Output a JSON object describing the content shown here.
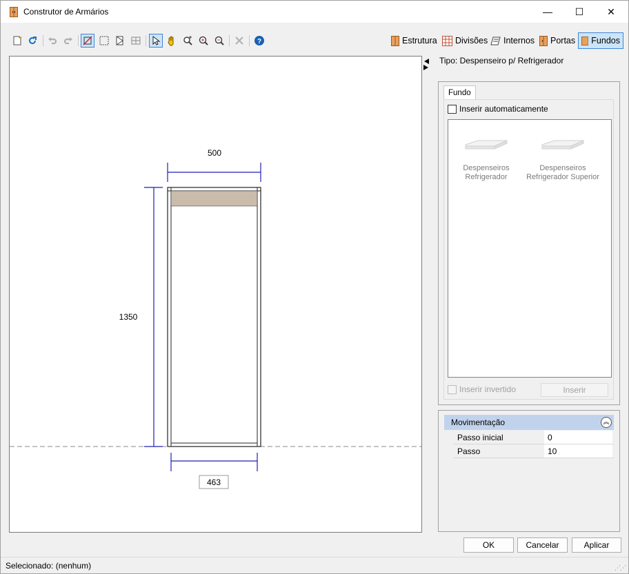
{
  "window": {
    "title": "Construtor de Armários",
    "minimize_glyph": "—",
    "maximize_glyph": "☐",
    "close_glyph": "✕"
  },
  "toolbar": {
    "modes": [
      {
        "label": "Estrutura",
        "icon": "cabinet-icon"
      },
      {
        "label": "Divisões",
        "icon": "grid-icon"
      },
      {
        "label": "Internos",
        "icon": "shelf-icon"
      },
      {
        "label": "Portas",
        "icon": "door-icon"
      },
      {
        "label": "Fundos",
        "icon": "back-panel-icon",
        "active": true
      }
    ]
  },
  "canvas": {
    "dim_width": "500",
    "dim_height": "1350",
    "dim_bottom": "463"
  },
  "panel": {
    "tipo": "Tipo: Despenseiro p/ Refrigerador",
    "tab_label": "Fundo",
    "auto_insert_label": "Inserir automaticamente",
    "items": [
      {
        "line1": "Despenseiros",
        "line2": "Refrigerador"
      },
      {
        "line1": "Despenseiros",
        "line2": "Refrigerador Superior"
      }
    ],
    "invert_label": "Inserir invertido",
    "insert_button": "Inserir"
  },
  "movimentacao": {
    "title": "Movimentação",
    "rows": [
      {
        "name": "Passo inicial",
        "value": "0"
      },
      {
        "name": "Passo",
        "value": "10"
      }
    ]
  },
  "buttons": {
    "ok": "OK",
    "cancel": "Cancelar",
    "apply": "Aplicar"
  },
  "status": {
    "text": "Selecionado: (nenhum)"
  },
  "colors": {
    "accent": "#3d86d6",
    "dimension_line": "#1f1fb4",
    "back_panel": "#c9bcab",
    "header_blue": "#c1d3ec"
  }
}
